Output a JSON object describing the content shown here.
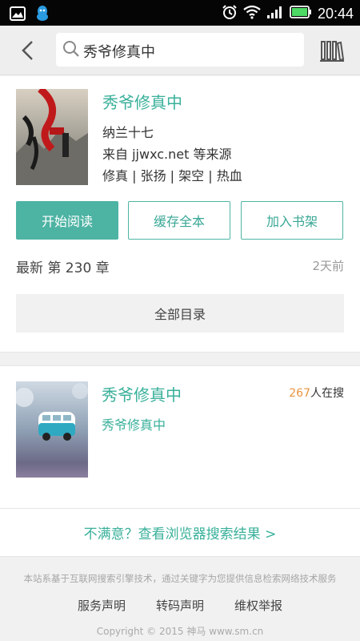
{
  "status_bar": {
    "time": "20:44",
    "icons": [
      "gallery-icon",
      "qq-icon",
      "alarm-icon",
      "wifi-icon",
      "signal-icon",
      "battery-icon"
    ]
  },
  "header": {
    "search_value": "秀爷修真中",
    "back_icon": "chevron-left-icon",
    "shelf_icon": "bookshelf-icon"
  },
  "book1": {
    "title": "秀爷修真中",
    "author": "纳兰十七",
    "source": "来自 jjwxc.net 等来源",
    "tags": "修真 | 张扬 | 架空 | 热血",
    "buttons": {
      "read": "开始阅读",
      "cache": "缓存全本",
      "add_shelf": "加入书架"
    },
    "latest": "最新 第 230 章",
    "latest_time": "2天前",
    "toc": "全部目录"
  },
  "book2": {
    "title": "秀爷修真中",
    "search_count": "267",
    "search_suffix": "人在搜",
    "subtitle": "秀爷修真中"
  },
  "more": {
    "label": "不满意？查看浏览器搜索结果 >"
  },
  "footer": {
    "disclaimer": "本站系基于互联网搜索引擎技术，通过关键字为您提供信息检索网络技术服务",
    "links": [
      "服务声明",
      "转码声明",
      "维权举报"
    ],
    "copyright": "Copyright © 2015 神马 www.sm.cn"
  },
  "colors": {
    "accent": "#4db3a3",
    "accent_text": "#39b09a",
    "count": "#e8953f"
  }
}
